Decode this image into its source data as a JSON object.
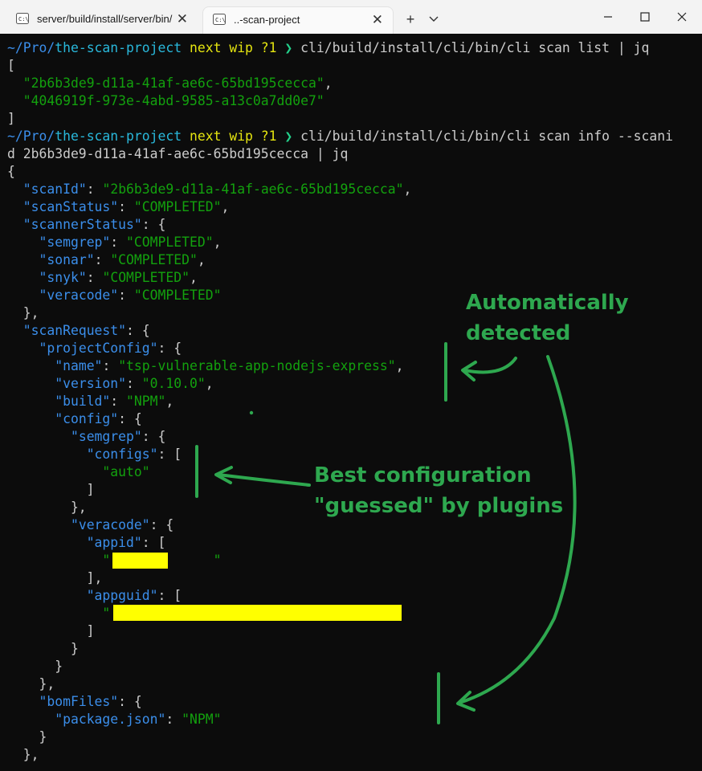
{
  "window": {
    "tabs": [
      {
        "label": "server/build/install/server/bin/",
        "active": false
      },
      {
        "label": "..-scan-project",
        "active": true
      }
    ],
    "new_tab": "+",
    "close_glyph": "✕"
  },
  "prompt": {
    "path_prefix": "~/Pro/",
    "project": "the-scan-project",
    "branch": "next wip ?1",
    "chevron": "❯"
  },
  "terminal": {
    "cmd1": "cli/build/install/cli/bin/cli scan list | jq",
    "cmd2a": "cli/build/install/cli/bin/cli scan info --scani",
    "cmd2b": "d 2b6b3de9-d11a-41af-ae6c-65bd195cecca | jq",
    "list_ids": [
      "\"2b6b3de9-d11a-41af-ae6c-65bd195cecca\"",
      "\"4046919f-973e-4abd-9585-a13c0a7dd0e7\""
    ],
    "k_scanId": "\"scanId\"",
    "v_scanId": "\"2b6b3de9-d11a-41af-ae6c-65bd195cecca\"",
    "k_scanStatus": "\"scanStatus\"",
    "v_completed": "\"COMPLETED\"",
    "k_scannerStatus": "\"scannerStatus\"",
    "k_semgrep": "\"semgrep\"",
    "k_sonar": "\"sonar\"",
    "k_snyk": "\"snyk\"",
    "k_veracode": "\"veracode\"",
    "k_scanRequest": "\"scanRequest\"",
    "k_projectConfig": "\"projectConfig\"",
    "k_name": "\"name\"",
    "v_name": "\"tsp-vulnerable-app-nodejs-express\"",
    "k_version": "\"version\"",
    "v_version": "\"0.10.0\"",
    "k_build": "\"build\"",
    "v_npm": "\"NPM\"",
    "k_config": "\"config\"",
    "k_configs": "\"configs\"",
    "v_auto": "\"auto\"",
    "k_appid": "\"appid\"",
    "k_appguid": "\"appguid\"",
    "k_bomFiles": "\"bomFiles\"",
    "k_package": "\"package.json\""
  },
  "annotations": {
    "auto_1": "Automatically",
    "auto_2": "detected",
    "best_1": "Best configuration",
    "best_2": "\"guessed\" by plugins",
    "color": "#2ea84f"
  },
  "redaction_color": "#ffff00"
}
